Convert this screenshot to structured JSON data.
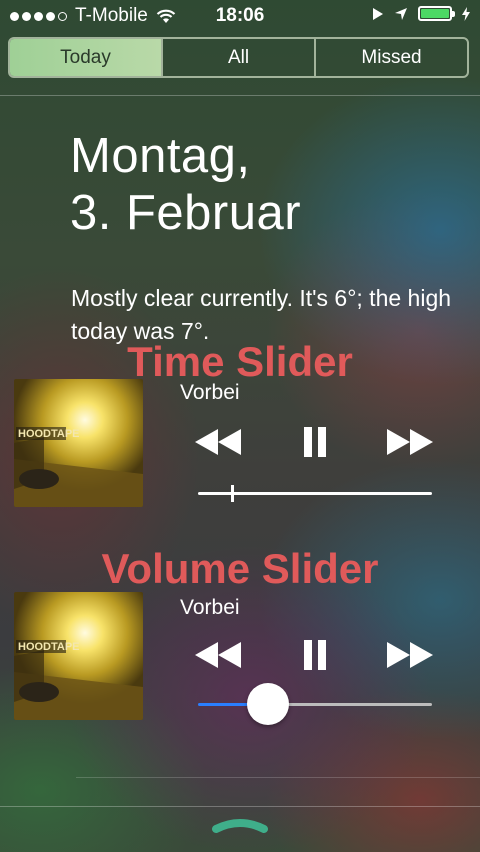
{
  "status_bar": {
    "carrier": "T-Mobile",
    "time": "18:06",
    "signal_bars_filled": 4,
    "signal_bars_total": 5,
    "battery_level": 1.0
  },
  "tabs": [
    {
      "label": "Today",
      "active": true
    },
    {
      "label": "All",
      "active": false
    },
    {
      "label": "Missed",
      "active": false
    }
  ],
  "date": {
    "line1": "Montag,",
    "line2": "3. Februar"
  },
  "weather": {
    "text": "Mostly clear currently. It's 6°; the high today was 7°."
  },
  "annotations": {
    "time_slider": "Time Slider",
    "volume_slider": "Volume Slider"
  },
  "album_text": "HOODTAPE",
  "player1": {
    "title": "Vorbei",
    "playback_position": 0.14
  },
  "player2": {
    "title": "Vorbei",
    "volume_level": 0.3
  },
  "colors": {
    "accent_active_tab": "#a8d69c",
    "annotation": "#e05a5a",
    "volume_fill": "#2a7fff",
    "battery": "#4cd964",
    "grabber": "#3fae8a"
  },
  "icons": [
    "wifi-icon",
    "play-arrow-icon",
    "location-arrow-icon",
    "battery-icon",
    "charging-bolt-icon",
    "rewind-icon",
    "pause-icon",
    "fast-forward-icon",
    "grabber-handle-icon"
  ]
}
